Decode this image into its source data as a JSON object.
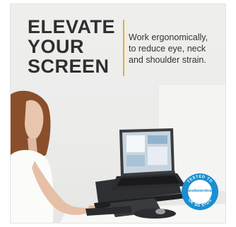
{
  "headline": {
    "lines": [
      "ELEVATE",
      "YOUR",
      "SCREEN"
    ]
  },
  "tagline": {
    "lines": [
      "Work ergonomically,",
      "to reduce eye, neck",
      "and shoulder strain."
    ]
  },
  "badge": {
    "top_text": "TESTED TO",
    "brand": "bestbeterdrue",
    "bottom_text": "UK SG STDS"
  },
  "colors": {
    "headline": "#2f2f2f",
    "accent": "#e9b020",
    "badge": "#1a8fd0"
  },
  "icons": [
    "laptop-icon",
    "certification-badge-icon"
  ]
}
